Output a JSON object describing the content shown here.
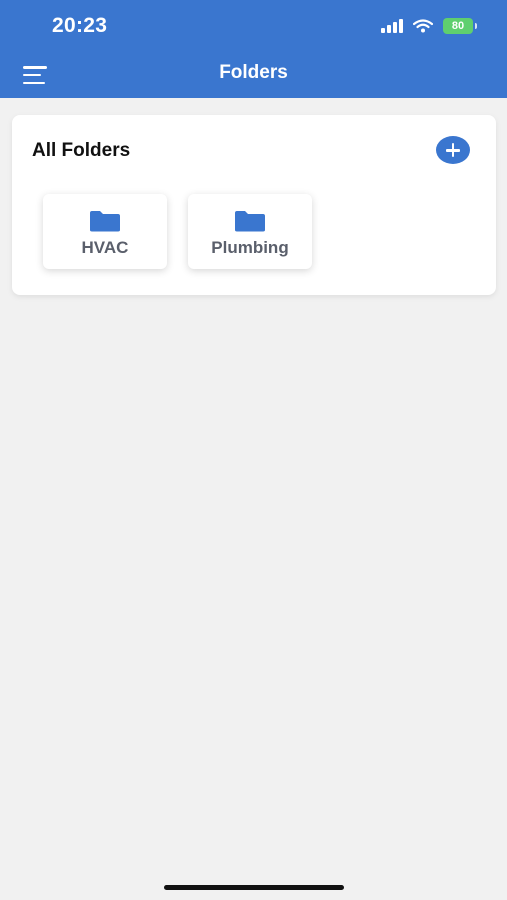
{
  "status_bar": {
    "time": "20:23",
    "battery": "80"
  },
  "header": {
    "title": "Folders",
    "menu_icon": "hamburger-menu-icon"
  },
  "card": {
    "title": "All Folders",
    "add_icon": "plus-circle-icon"
  },
  "folders": [
    {
      "label": "HVAC",
      "icon": "folder-icon"
    },
    {
      "label": "Plumbing",
      "icon": "folder-icon"
    }
  ],
  "colors": {
    "accent": "#3a76cf",
    "background": "#f1f1f1",
    "folder_label": "#5a5f6b",
    "battery": "#5fcf6f"
  }
}
